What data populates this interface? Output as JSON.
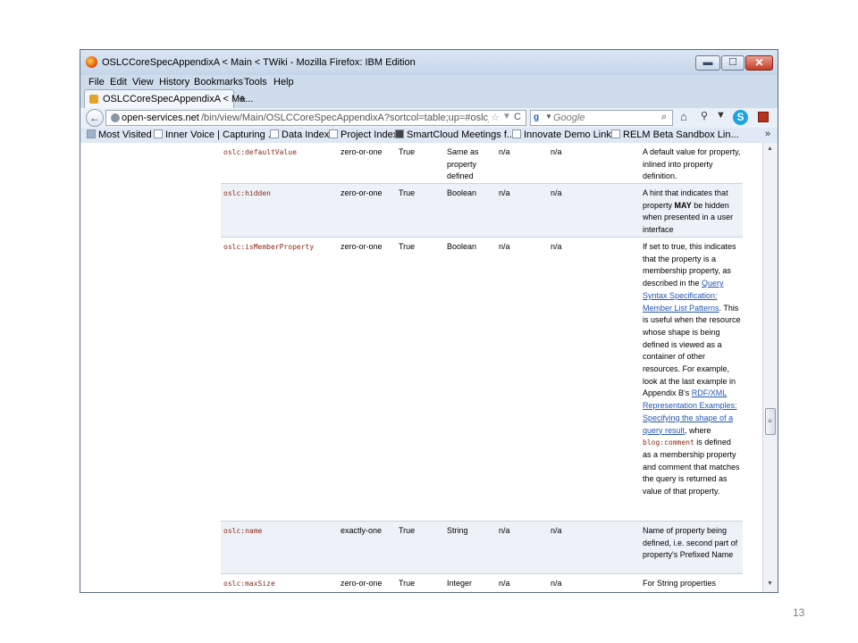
{
  "window": {
    "title": "OSLCCoreSpecAppendixA < Main < TWiki - Mozilla Firefox: IBM Edition",
    "min_glyph": "▬",
    "max_glyph": "☐",
    "close_glyph": "✕"
  },
  "menu": [
    "File",
    "Edit",
    "View",
    "History",
    "Bookmarks",
    "Tools",
    "Help"
  ],
  "tab": {
    "title": "OSLCCoreSpecAppendixA < Ma...",
    "close_glyph": "×",
    "new_tab_glyph": "+"
  },
  "nav": {
    "url_host": "open-services.net",
    "url_path": "/bin/view/Main/OSLCCoreSpecAppendixA?sortcol=table;up=#oslc_Resource",
    "search_placeholder": "Google",
    "back_glyph": "←",
    "star_glyph": "☆",
    "dropdown_glyph": "▼",
    "reload_glyph": "C",
    "search_go_glyph": "⌕",
    "home_glyph": "⌂",
    "skype_glyph": "S"
  },
  "bookmarks": [
    "Most Visited",
    "Inner Voice | Capturing ...",
    "Data Index",
    "Project Index",
    "SmartCloud Meetings f...",
    "Innovate Demo Links",
    "RELM Beta Sandbox Lin..."
  ],
  "table": {
    "rows": [
      {
        "name": "oslc:defaultValue",
        "occurs": "zero-or-one",
        "read_only": "True",
        "value_type": "Same as property defined",
        "representation": "n/a",
        "range": "n/a",
        "description": "A default value for property, inlined into property definition."
      },
      {
        "name": "oslc:hidden",
        "occurs": "zero-or-one",
        "read_only": "True",
        "value_type": "Boolean",
        "representation": "n/a",
        "range": "n/a",
        "description_parts": [
          "A hint that indicates that property ",
          "MAY",
          " be hidden when presented in a user interface"
        ]
      },
      {
        "name": "oslc:isMemberProperty",
        "occurs": "zero-or-one",
        "read_only": "True",
        "value_type": "Boolean",
        "representation": "n/a",
        "range": "n/a",
        "description_parts": [
          "If set to true, this indicates that the property is a membership property, as described in the ",
          "Query Syntax Specification: Member List Patterns",
          ". This is useful when the resource whose shape is being defined is viewed as a container of other resources. For example, look at the last example in Appendix B's ",
          "RDF/XML Representation Examples: Specifying the shape of a query result",
          ", where ",
          "blog:comment",
          " is defined as a membership property and comment that matches the query is returned as value of that property."
        ]
      },
      {
        "name": "oslc:name",
        "occurs": "exactly-one",
        "read_only": "True",
        "value_type": "String",
        "representation": "n/a",
        "range": "n/a",
        "description": "Name of property being defined, i.e. second part of property's Prefixed Name"
      },
      {
        "name": "oslc:maxSize",
        "occurs": "zero-or-one",
        "read_only": "True",
        "value_type": "Integer",
        "representation": "n/a",
        "range": "n/a",
        "description": "For String properties"
      }
    ]
  },
  "scrollbar": {
    "up_glyph": "▲",
    "down_glyph": "▼",
    "grip_glyph": "≡"
  },
  "page_number": "13"
}
